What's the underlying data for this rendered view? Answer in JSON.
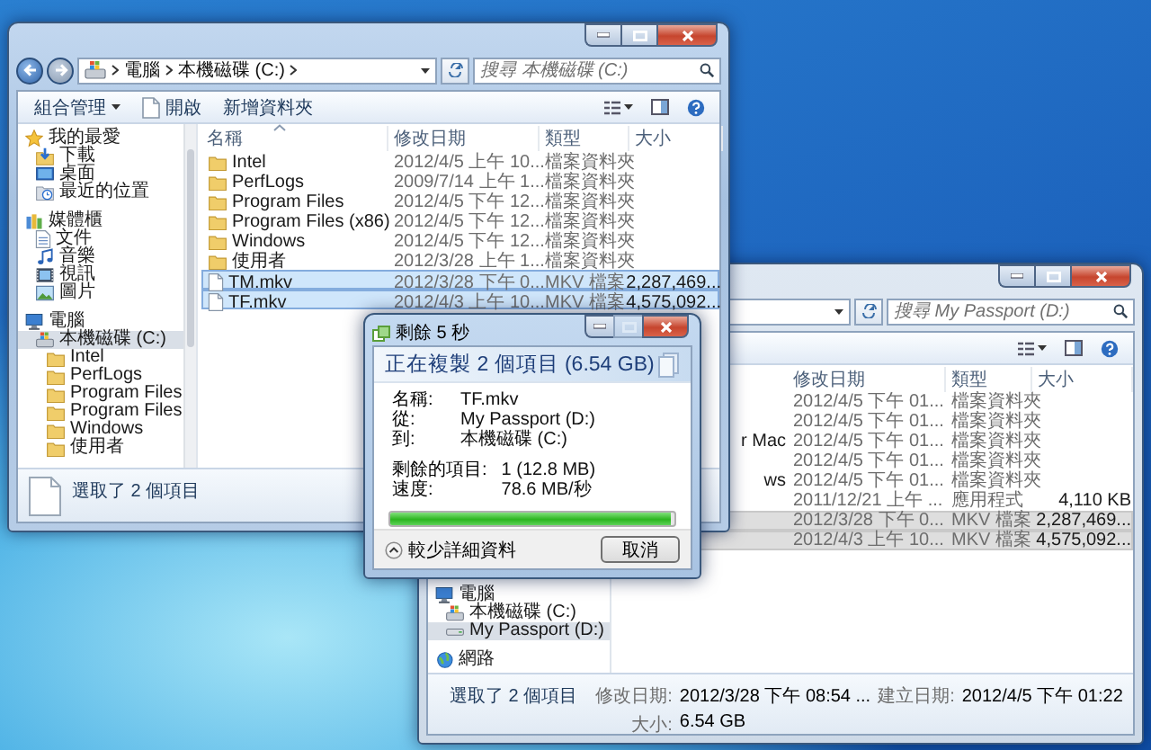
{
  "windows": [
    {
      "focused": true,
      "address": {
        "crumbs": [
          "電腦",
          "本機磁碟 (C:)"
        ],
        "search_placeholder": "搜尋 本機磁碟 (C:)"
      },
      "toolbar": [
        {
          "label": "組合管理",
          "kind": "menu"
        },
        {
          "label": "開啟",
          "kind": "open"
        },
        {
          "label": "新增資料夾",
          "kind": "plain"
        }
      ],
      "nav": [
        {
          "label": "我的最愛",
          "kind": "star",
          "selected": false,
          "children": [
            {
              "label": "下載",
              "kind": "download",
              "selected": false
            },
            {
              "label": "桌面",
              "kind": "desktop",
              "selected": false
            },
            {
              "label": "最近的位置",
              "kind": "recent",
              "selected": false
            }
          ]
        },
        {
          "label": "媒體櫃",
          "kind": "library",
          "selected": false,
          "children": [
            {
              "label": "文件",
              "kind": "document",
              "selected": false
            },
            {
              "label": "音樂",
              "kind": "music",
              "selected": false
            },
            {
              "label": "視訊",
              "kind": "video",
              "selected": false
            },
            {
              "label": "圖片",
              "kind": "picture",
              "selected": false
            }
          ]
        },
        {
          "label": "電腦",
          "kind": "computer",
          "selected": false,
          "children": [
            {
              "label": "本機磁碟 (C:)",
              "kind": "drive",
              "selected": true,
              "children": [
                {
                  "label": "Intel",
                  "kind": "folder",
                  "selected": false
                },
                {
                  "label": "PerfLogs",
                  "kind": "folder",
                  "selected": false
                },
                {
                  "label": "Program Files",
                  "kind": "folder",
                  "selected": false
                },
                {
                  "label": "Program Files",
                  "kind": "folder",
                  "selected": false
                },
                {
                  "label": "Windows",
                  "kind": "folder",
                  "selected": false
                },
                {
                  "label": "使用者",
                  "kind": "folder",
                  "selected": false
                }
              ]
            }
          ]
        }
      ],
      "columns": [
        {
          "kind": "name",
          "label": "名稱"
        },
        {
          "kind": "date",
          "label": "修改日期"
        },
        {
          "kind": "type",
          "label": "類型"
        },
        {
          "kind": "size",
          "label": "大小"
        }
      ],
      "rows": [
        {
          "kind": "folder",
          "name": "Intel",
          "date": "2012/4/5 上午 10...",
          "type": "檔案資料夾",
          "selected": false
        },
        {
          "kind": "folder",
          "name": "PerfLogs",
          "date": "2009/7/14 上午 1...",
          "type": "檔案資料夾",
          "selected": false
        },
        {
          "kind": "folder",
          "name": "Program Files",
          "date": "2012/4/5 下午 12...",
          "type": "檔案資料夾",
          "selected": false
        },
        {
          "kind": "folder",
          "name": "Program Files (x86)",
          "date": "2012/4/5 下午 12...",
          "type": "檔案資料夾",
          "selected": false
        },
        {
          "kind": "folder",
          "name": "Windows",
          "date": "2012/4/5 下午 12...",
          "type": "檔案資料夾",
          "selected": false
        },
        {
          "kind": "folder",
          "name": "使用者",
          "date": "2012/3/28 上午 1...",
          "type": "檔案資料夾",
          "selected": false
        },
        {
          "kind": "file",
          "name": "TM.mkv",
          "date": "2012/3/28 下午 0...",
          "type": "MKV 檔案",
          "size": "2,287,469...",
          "selected": true
        },
        {
          "kind": "file",
          "name": "TF.mkv",
          "date": "2012/4/3 上午 10...",
          "type": "MKV 檔案",
          "size": "4,575,092...",
          "selected": true
        }
      ],
      "status": {
        "text": "選取了 2 個項目"
      }
    },
    {
      "focused": false,
      "address": {
        "search_placeholder": "搜尋 My Passport (D:)"
      },
      "nav": [
        {
          "label": "電腦",
          "kind": "computer",
          "selected": false,
          "children": [
            {
              "label": "本機磁碟 (C:)",
              "kind": "drive",
              "selected": false
            },
            {
              "label": "My Passport (D:)",
              "kind": "usb",
              "selected": true
            }
          ]
        },
        {
          "label": "網路",
          "kind": "network",
          "selected": false
        }
      ],
      "columns": [
        {
          "kind": "name"
        },
        {
          "kind": "date",
          "label": "修改日期"
        },
        {
          "kind": "type",
          "label": "類型"
        },
        {
          "kind": "size",
          "label": "大小"
        }
      ],
      "rows": [
        {
          "date": "2012/4/5 下午 01...",
          "type": "檔案資料夾",
          "selected": false
        },
        {
          "date": "2012/4/5 下午 01...",
          "type": "檔案資料夾",
          "selected": false
        },
        {
          "name": "r Mac",
          "date": "2012/4/5 下午 01...",
          "type": "檔案資料夾",
          "selected": false
        },
        {
          "date": "2012/4/5 下午 01...",
          "type": "檔案資料夾",
          "selected": false
        },
        {
          "name": "ws",
          "date": "2012/4/5 下午 01...",
          "type": "檔案資料夾",
          "selected": false
        },
        {
          "date": "2011/12/21 上午 ...",
          "type": "應用程式",
          "size": "4,110 KB",
          "selected": false
        },
        {
          "date": "2012/3/28 下午 0...",
          "type": "MKV 檔案",
          "size": "2,287,469...",
          "selected": true
        },
        {
          "date": "2012/4/3 上午 10...",
          "type": "MKV 檔案",
          "size": "4,575,092...",
          "selected": true
        }
      ],
      "status": {
        "text": "選取了 2 個項目",
        "details": [
          {
            "label": "修改日期:",
            "value": "2012/3/28 下午 08:54 ..."
          },
          {
            "label": "建立日期:",
            "value": "2012/4/5 下午 01:22"
          },
          {
            "label": "大小:",
            "value": "6.54 GB"
          }
        ]
      }
    }
  ],
  "dialog": {
    "title": "剩餘 5 秒",
    "caption_buttons": [
      {
        "kind": "minimize",
        "disabled": false
      },
      {
        "kind": "maximize",
        "disabled": true
      },
      {
        "kind": "close",
        "disabled": false
      }
    ],
    "heading": "正在複製 2 個項目 (6.54 GB)",
    "details": [
      {
        "label": "名稱:",
        "value": "TF.mkv"
      },
      {
        "label": "從:",
        "value": "My Passport (D:)"
      },
      {
        "label": "到:",
        "value": "本機磁碟 (C:)"
      }
    ],
    "stats": [
      {
        "label": "剩餘的項目:",
        "value": "1 (12.8 MB)"
      },
      {
        "label": "速度:",
        "value": "78.6 MB/秒"
      }
    ],
    "progress": {
      "level": 0.99
    },
    "toggle": "較少詳細資料",
    "buttons": [
      "取消"
    ]
  }
}
